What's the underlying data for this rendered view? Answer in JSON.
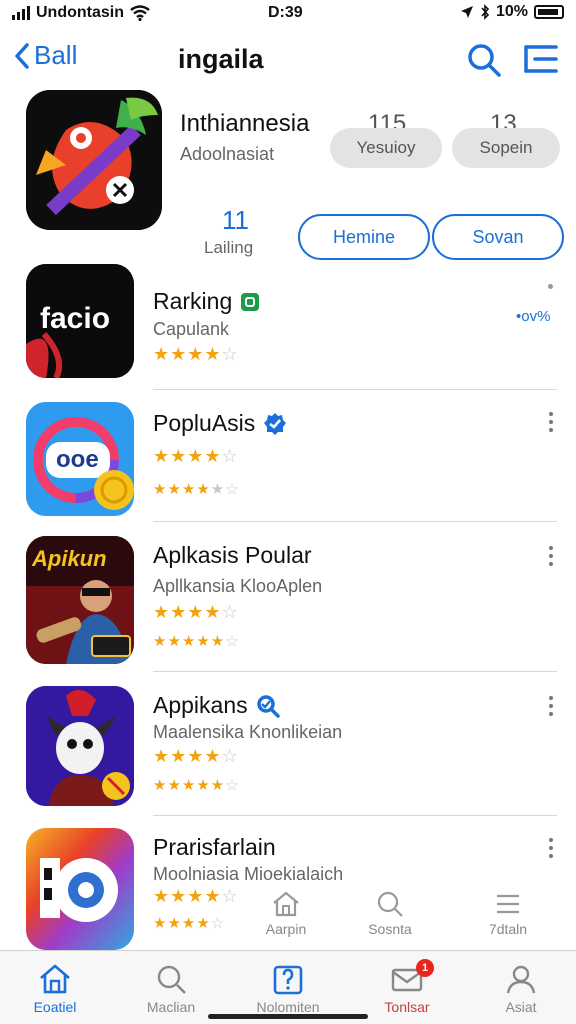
{
  "status": {
    "carrier": "Undontasin",
    "time": "D:39",
    "battery": "10%"
  },
  "nav": {
    "back_label": "Ball",
    "title": "ingaila"
  },
  "hero": {
    "name": "Inthiannesia",
    "subtitle": "Adoolnasiat",
    "stat1_value": "115",
    "stat1_label": "Yesuioy",
    "stat2_value": "13.",
    "stat2_label": "Sopein",
    "rank_value": "11",
    "rank_label": "Lailing",
    "button1": "Hemine",
    "button2": "Sovan"
  },
  "apps": [
    {
      "title": "Rarking",
      "subtitle": "Capulank",
      "icon_text": "facio",
      "trailing": "•ov%",
      "stars": 4,
      "stars2": null
    },
    {
      "title": "PopluAsis",
      "subtitle": "",
      "icon_text": "ooe",
      "stars": 4,
      "stars2": 4.5
    },
    {
      "title": "Aplkasis Poular",
      "subtitle": "Apllkansia KlooAplen",
      "icon_text": "Apikun",
      "stars": 4,
      "stars2": 4.5
    },
    {
      "title": "Appikans",
      "subtitle": "Maalensika Knonlikeian",
      "icon_text": "",
      "stars": 4.5,
      "stars2": 4.5
    },
    {
      "title": "Prarisfarlain",
      "subtitle": "Moolniasia Mioekialaich",
      "icon_text": "",
      "stars": 4.5,
      "stars2": 4.5
    }
  ],
  "mini_tabs": [
    {
      "label": "Aarpin",
      "icon": "house-icon"
    },
    {
      "label": "Sosnta",
      "icon": "search-icon"
    },
    {
      "label": "7dtaln",
      "icon": "list-icon"
    }
  ],
  "tabs": [
    {
      "label": "Eoatiel",
      "icon": "home-icon",
      "active": true
    },
    {
      "label": "Maclian",
      "icon": "search-icon",
      "active": false
    },
    {
      "label": "Nolomiten",
      "icon": "notification-icon",
      "active": false
    },
    {
      "label": "Tonlsar",
      "icon": "mail-icon",
      "active": false,
      "badge": "1"
    },
    {
      "label": "Asiat",
      "icon": "profile-icon",
      "active": false
    }
  ],
  "colors": {
    "accent": "#1a6fd8",
    "star": "#f2a30f",
    "badge": "#e8261d",
    "verified": "#1a6fd8",
    "green_badge": "#1e9b4a"
  }
}
